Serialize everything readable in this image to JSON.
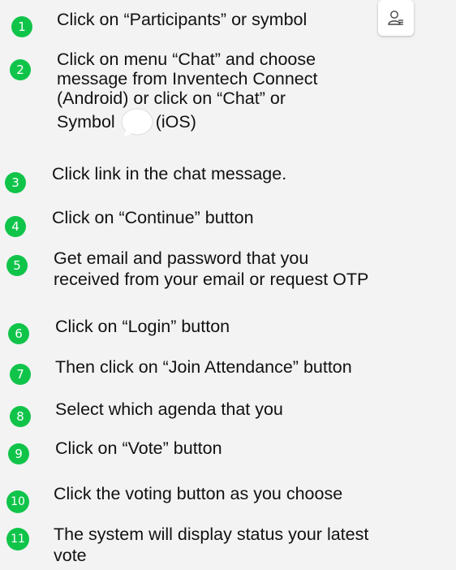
{
  "steps": [
    {
      "number": "1",
      "text": "Click on “Participants” or symbol"
    },
    {
      "number": "2",
      "lines": [
        "Click on menu “Chat” and choose",
        "message from Inventech Connect",
        "(Android) or click on “Chat” or"
      ],
      "line4_prefix": "Symbol",
      "line4_suffix": "(iOS)"
    },
    {
      "number": "3",
      "text": "Click link in the chat message."
    },
    {
      "number": "4",
      "text": "Click on “Continue” button"
    },
    {
      "number": "5",
      "lines": [
        "Get email and password that you",
        "received from your email or request OTP"
      ]
    },
    {
      "number": "6",
      "text": "Click on “Login” button"
    },
    {
      "number": "7",
      "text": "Then click on “Join Attendance” button"
    },
    {
      "number": "8",
      "text": "Select which agenda that you"
    },
    {
      "number": "9",
      "text": "Click on “Vote” button"
    },
    {
      "number": "10",
      "text": "Click the voting button as you choose"
    },
    {
      "number": "11",
      "lines": [
        "The system will display status your latest",
        "vote"
      ]
    }
  ],
  "icons": {
    "participants": "participants-icon",
    "chat": "chat-bubble-icon"
  },
  "colors": {
    "badge": "#10c44a",
    "background": "#f3f3f3",
    "text": "#111111"
  }
}
